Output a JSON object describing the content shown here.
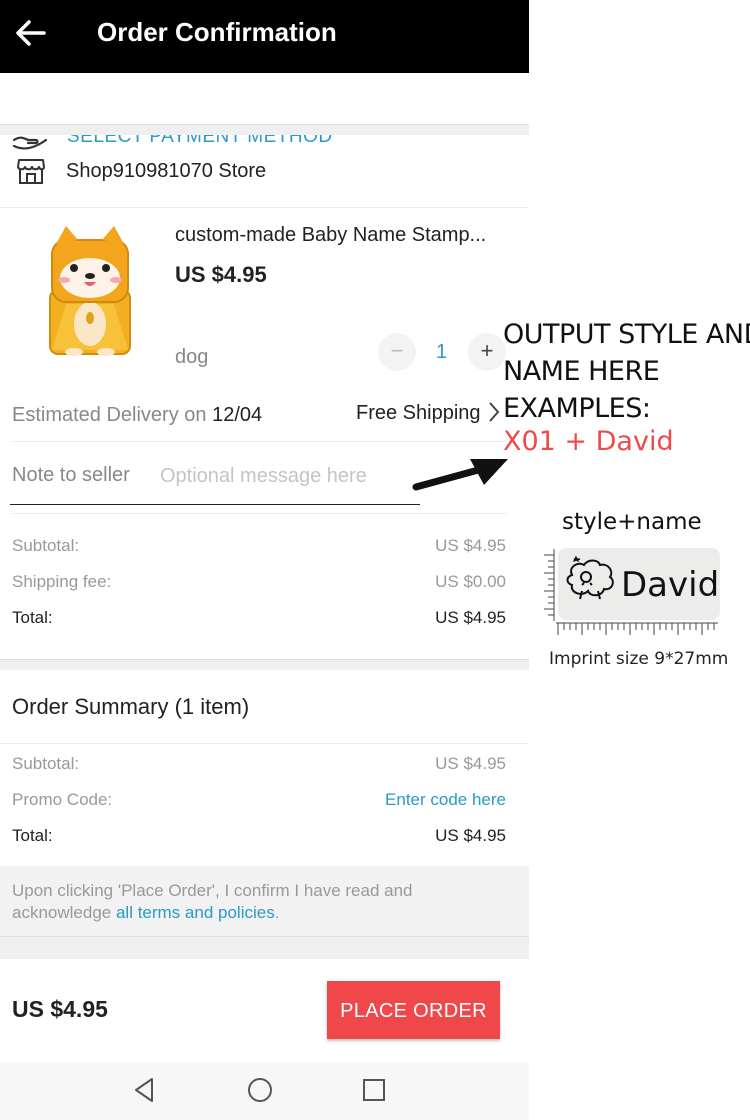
{
  "header": {
    "title": "Order Confirmation"
  },
  "payment": {
    "label": "SELECT PAYMENT METHOD"
  },
  "store": {
    "name": "Shop910981070 Store"
  },
  "product": {
    "title": "custom-made Baby Name Stamp...",
    "price": "US $4.95",
    "variant": "dog",
    "quantity": "1",
    "qty_minus": "−",
    "qty_plus": "+"
  },
  "delivery": {
    "label": "Estimated Delivery on ",
    "date": "12/04",
    "shipping": "Free Shipping"
  },
  "note": {
    "label": "Note to seller",
    "placeholder": "Optional message here"
  },
  "costs": {
    "subtotal_label": "Subtotal:",
    "subtotal_value": "US $4.95",
    "shipping_label": "Shipping fee:",
    "shipping_value": "US $0.00",
    "total_label": "Total:",
    "total_value": "US $4.95"
  },
  "summary": {
    "title": "Order Summary (1 item)",
    "subtotal_label": "Subtotal:",
    "subtotal_value": "US $4.95",
    "promo_label": "Promo Code:",
    "promo_link": "Enter code here",
    "total_label": "Total:",
    "total_value": "US $4.95"
  },
  "terms": {
    "text": "Upon clicking 'Place Order', I confirm I have read and acknowledge ",
    "link": "all terms and policies",
    "end": "."
  },
  "footer": {
    "total": "US $4.95",
    "place_order": "PLACE ORDER"
  },
  "overlay": {
    "line1": "OUTPUT STYLE AND",
    "line2": "NAME HERE",
    "line3": "EXAMPLES:",
    "example": "X01  +  David",
    "style_label": "style+name",
    "stamp_name": "David",
    "imprint": "Imprint size 9*27mm"
  },
  "colors": {
    "accent": "#2a9bc6",
    "button": "#f0474b",
    "example_red": "#ef4a4a"
  },
  "icons": [
    "back-arrow-icon",
    "hand-payment-icon",
    "store-icon",
    "chevron-right-icon",
    "nav-back-icon",
    "nav-home-icon",
    "nav-recents-icon"
  ]
}
